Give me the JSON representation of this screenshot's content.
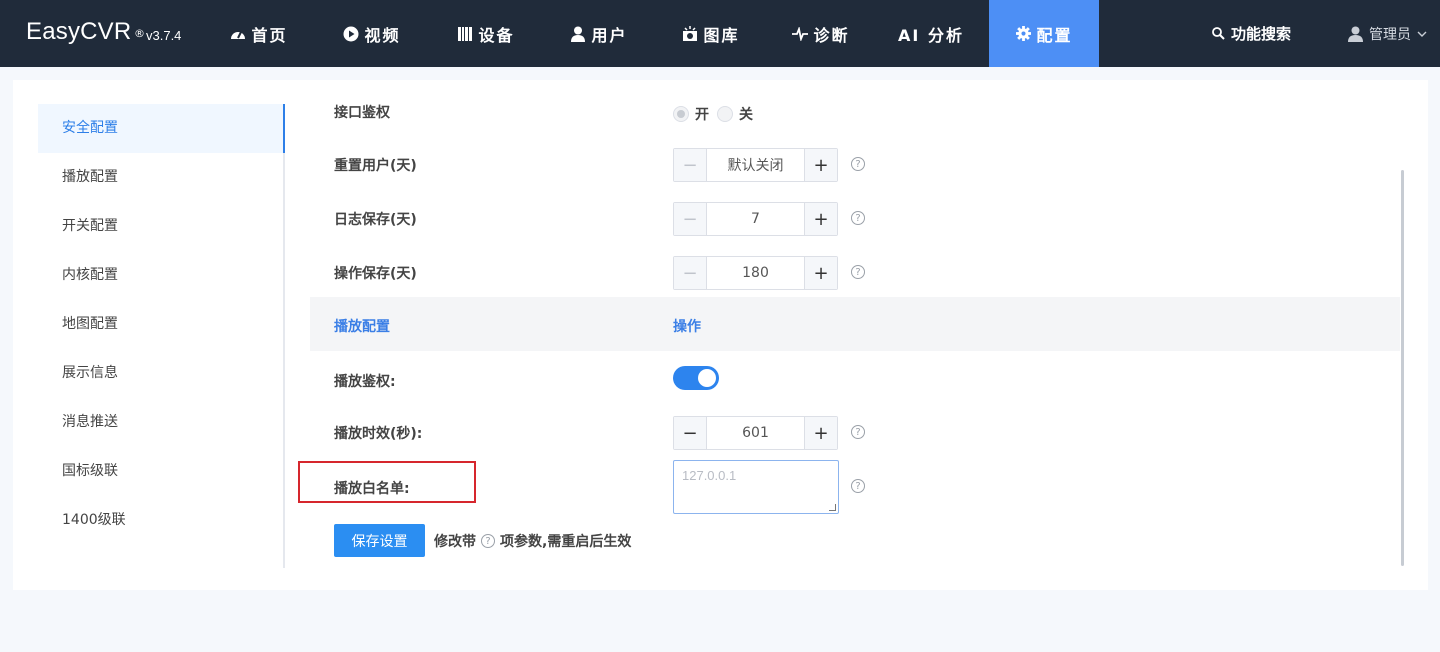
{
  "app": {
    "name": "EasyCVR",
    "registered": "®",
    "version": "v3.7.4"
  },
  "nav": {
    "items": [
      {
        "icon": "dashboard-icon",
        "label": "首页"
      },
      {
        "icon": "play-circle-icon",
        "label": "视频"
      },
      {
        "icon": "device-icon",
        "label": "设备"
      },
      {
        "icon": "user-icon",
        "label": "用户"
      },
      {
        "icon": "gallery-icon",
        "label": "图库"
      },
      {
        "icon": "pulse-icon",
        "label": "诊断"
      },
      {
        "icon": "",
        "label": "AI 分析"
      },
      {
        "icon": "gear-icon",
        "label": "配置"
      }
    ],
    "active_index": 7,
    "search_label": "功能搜索",
    "user_label": "管理员"
  },
  "sidebar": {
    "items": [
      "安全配置",
      "播放配置",
      "开关配置",
      "内核配置",
      "地图配置",
      "展示信息",
      "消息推送",
      "国标级联",
      "1400级联"
    ],
    "active_index": 0
  },
  "form": {
    "api_auth": {
      "label": "接口鉴权",
      "on_label": "开",
      "off_label": "关",
      "selected": "开"
    },
    "reset_user": {
      "label": "重置用户(天)",
      "value": "默认关闭"
    },
    "log_keep": {
      "label": "日志保存(天)",
      "value": "7"
    },
    "op_keep": {
      "label": "操作保存(天)",
      "value": "180"
    },
    "section": {
      "title": "播放配置",
      "action": "操作"
    },
    "play_auth": {
      "label": "播放鉴权:",
      "enabled": true
    },
    "play_timeout": {
      "label": "播放时效(秒):",
      "value": "601"
    },
    "play_whitelist": {
      "label": "播放白名单:",
      "placeholder": "127.0.0.1"
    },
    "help_glyph": "?",
    "save_label": "保存设置",
    "note_prefix": "修改带",
    "note_suffix": "项参数,需重启后生效"
  },
  "colors": {
    "nav_bg": "#202b3a",
    "accent": "#4d8ff5",
    "primary_button": "#2b8ef2",
    "highlight_box": "#d6262d"
  }
}
